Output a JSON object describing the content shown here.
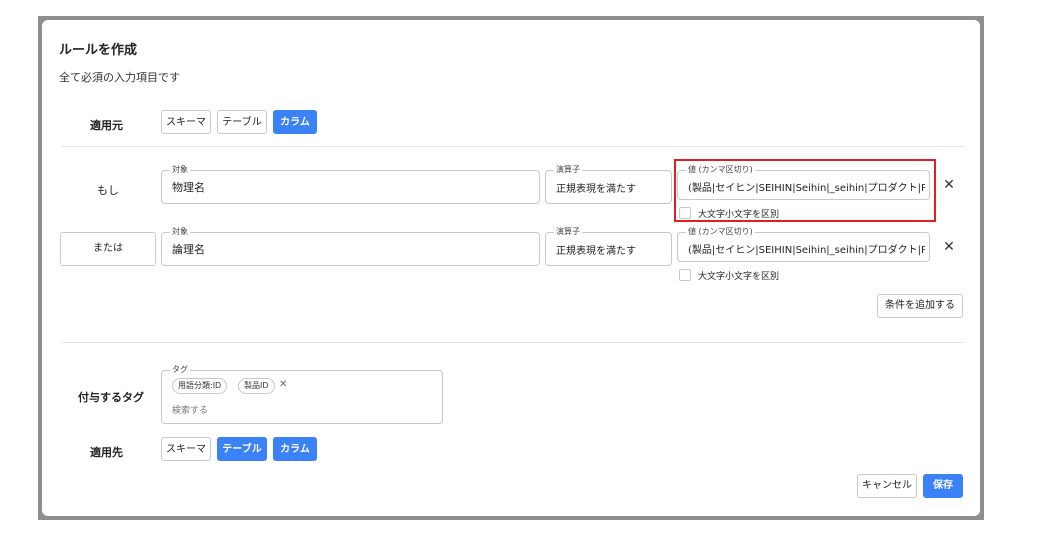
{
  "dialog": {
    "title": "ルールを作成",
    "subtitle": "全て必須の入力項目です"
  },
  "apply_source": {
    "label": "適用元",
    "options": [
      {
        "label": "スキーマ",
        "active": false
      },
      {
        "label": "テーブル",
        "active": false
      },
      {
        "label": "カラム",
        "active": true
      }
    ]
  },
  "conditions": [
    {
      "connector": "もし",
      "target_label": "対象",
      "target_value": "物理名",
      "operator_label": "演算子",
      "operator_value": "正規表現を満たす",
      "value_label": "値 (カンマ区切り)",
      "value": "(製品|セイヒン|SEIHIN|Seihin|_seihin|プロダクト|PROI",
      "case_label": "大文字小文字を区別",
      "case_checked": false,
      "highlighted": true
    },
    {
      "connector": "または",
      "target_label": "対象",
      "target_value": "論理名",
      "operator_label": "演算子",
      "operator_value": "正規表現を満たす",
      "value_label": "値 (カンマ区切り)",
      "value": "(製品|セイヒン|SEIHIN|Seihin|_seihin|プロダクト|PROI",
      "case_label": "大文字小文字を区別",
      "case_checked": false,
      "highlighted": false
    }
  ],
  "add_condition_label": "条件を追加する",
  "tags": {
    "row_label": "付与するタグ",
    "field_label": "タグ",
    "chips": [
      "用語分類:ID",
      "製品ID"
    ],
    "search_placeholder": "検索する"
  },
  "apply_target": {
    "label": "適用先",
    "options": [
      {
        "label": "スキーマ",
        "active": false
      },
      {
        "label": "テーブル",
        "active": true
      },
      {
        "label": "カラム",
        "active": true
      }
    ]
  },
  "footer": {
    "cancel_label": "キャンセル",
    "save_label": "保存"
  },
  "icons": {
    "remove": "close-icon",
    "chip_remove": "close-icon"
  },
  "colors": {
    "primary": "#3b82f6",
    "highlight": "#e02020"
  }
}
